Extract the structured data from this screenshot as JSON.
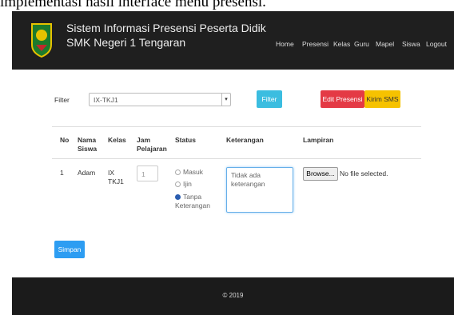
{
  "caption": "implementasi hasil interface menu presensi.",
  "app": {
    "title_line1": "Sistem Informasi Presensi Peserta Didik",
    "title_line2": "SMK Negeri 1 Tengaran"
  },
  "nav": [
    "Home",
    "Presensi",
    "Kelas",
    "Guru",
    "Mapel",
    "Siswa",
    "Logout"
  ],
  "filter": {
    "label": "Filter",
    "selected": "IX-TKJ1",
    "button": "Filter"
  },
  "actions": {
    "edit": "Edit Presensi",
    "sms": "Kirim SMS"
  },
  "table": {
    "headers": [
      "No",
      "Nama Siswa",
      "Kelas",
      "Jam Pelajaran",
      "Status",
      "Keterangan",
      "Lampiran"
    ],
    "rows": [
      {
        "no": "1",
        "nama": "Adam",
        "kelas": "IX TKJ1",
        "jam_placeholder": "1",
        "status_options": [
          "Masuk",
          "Ijin",
          "Tanpa Keterangan"
        ],
        "status_selected": "Tanpa Keterangan",
        "keterangan_placeholder": "Tidak ada keterangan",
        "browse_label": "Browse...",
        "file_status": "No file selected."
      }
    ]
  },
  "save_button": "Simpan",
  "footer": "© 2019",
  "colors": {
    "navbar": "#1f1f1f",
    "filter_btn": "#3bbde0",
    "edit_btn": "#e43a45",
    "sms_btn": "#f6c200",
    "save_btn": "#2d9df2"
  }
}
